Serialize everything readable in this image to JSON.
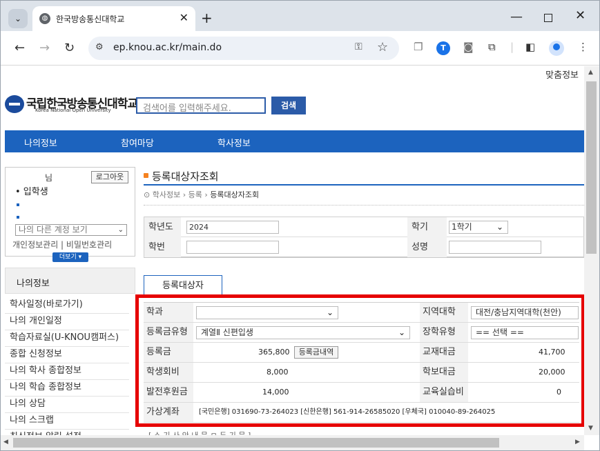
{
  "browser": {
    "tab_title": "한국방송통신대학교",
    "new_tab": "+",
    "url": "ep.knou.ac.kr/main.do",
    "extension_label": "T"
  },
  "site": {
    "custom_info": "맞춤정보",
    "logo_kr": "국립한국방송통신대학교",
    "logo_en": "Korea National Open University",
    "search_placeholder": "검색어를 입력해주세요.",
    "search_button": "검색",
    "gnb": [
      "나의정보",
      "참여마당",
      "학사정보"
    ]
  },
  "sidebar": {
    "user_suffix": "님",
    "logout": "로그아웃",
    "role": "• 입학생",
    "account_select": "나의 다른 계정 보기",
    "links": "개인정보관리  |  비밀번호관리",
    "more": "더보기 ▾",
    "section_title": "나의정보",
    "items": [
      "학사일정(바로가기)",
      "나의 개인일정",
      "학습자료실(U-KNOU캠퍼스)",
      "종합 신청정보",
      "나의 학사 종합정보",
      "나의 학습 종합정보",
      "나의 상담",
      "나의 스크랩",
      "최신정보 알림 설정"
    ]
  },
  "main": {
    "title": "등록대상자조회",
    "breadcrumb": [
      "학사정보",
      "등록",
      "등록대상자조회"
    ],
    "filter": {
      "year_label": "학년도",
      "year_value": "2024",
      "semester_label": "학기",
      "semester_value": "1학기",
      "student_no_label": "학번",
      "student_no_value": "",
      "name_label": "성명",
      "name_value": ""
    },
    "tab": "등록대상자",
    "detail": {
      "dept_label": "학과",
      "dept_value": "",
      "region_label": "지역대학",
      "region_value": "대전/충남지역대학(천안)",
      "fee_type_label": "등록금유형",
      "fee_type_value": "계열Ⅱ 신편입생",
      "scholarship_label": "장학유형",
      "scholarship_value": "== 선택 ==",
      "tuition_label": "등록금",
      "tuition_value": "365,800",
      "tuition_history_btn": "등록금내역",
      "textbook_label": "교재대금",
      "textbook_value": "41,700",
      "student_fee_label": "학생회비",
      "student_fee_value": "8,000",
      "paper_fee_label": "학보대금",
      "paper_fee_value": "20,000",
      "dev_fund_label": "발전후원금",
      "dev_fund_value": "14,000",
      "practice_fee_label": "교육실습비",
      "practice_fee_value": "0",
      "virtual_account_label": "가상계좌",
      "virtual_account_value": "[국민은행] 031690-73-264023 [신한은행] 561-914-26585020 [우체국] 010040-89-264025"
    },
    "cut_text": "[ 스 기 사 안 내 문 ㅁ 두 기 문 ]"
  },
  "colors": {
    "brand_blue": "#1c63be",
    "highlight_red": "#e60000",
    "title_dot": "#f58220"
  }
}
